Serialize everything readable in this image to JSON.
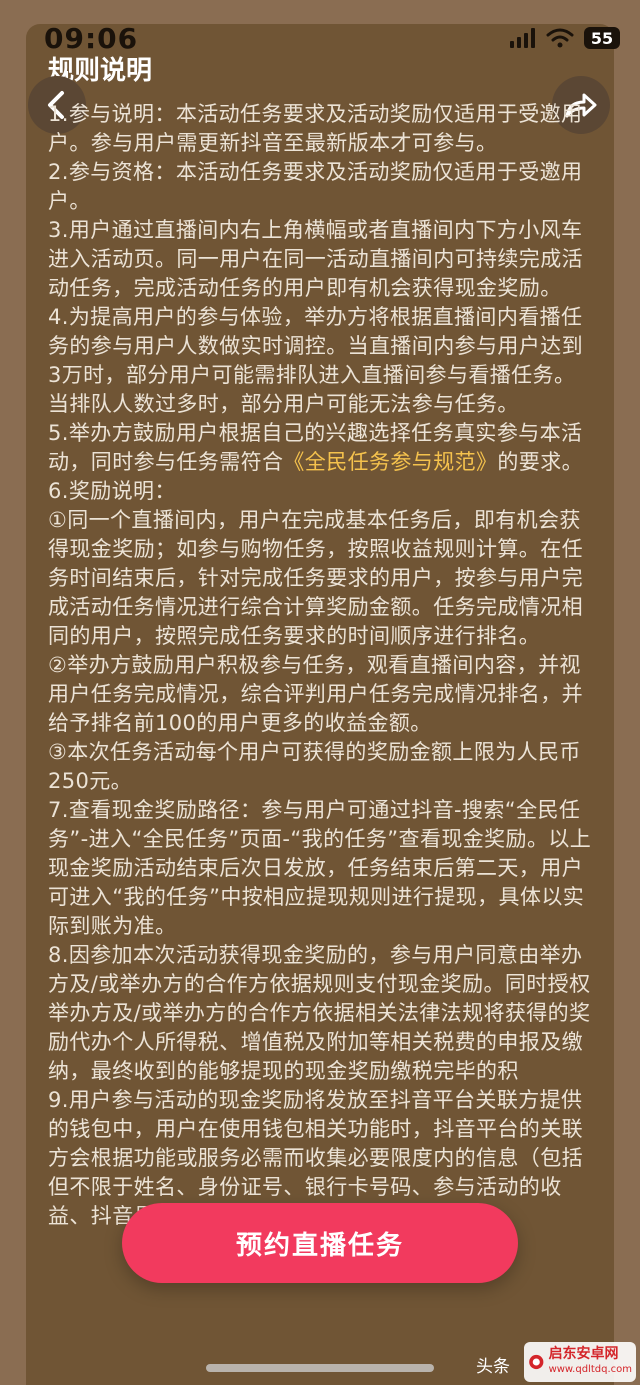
{
  "status_bar": {
    "time": "09:06",
    "battery": "55"
  },
  "header": {
    "title": "规则说明"
  },
  "rules": {
    "p1": "1.参与说明：本活动任务要求及活动奖励仅适用于受邀用户。参与用户需更新抖音至最新版本才可参与。",
    "p2": "2.参与资格：本活动任务要求及活动奖励仅适用于受邀用户。",
    "p3": "3.用户通过直播间内右上角横幅或者直播间内下方小风车进入活动页。同一用户在同一活动直播间内可持续完成活动任务，完成活动任务的用户即有机会获得现金奖励。",
    "p4": "4.为提高用户的参与体验，举办方将根据直播间内看播任务的参与用户人数做实时调控。当直播间内参与用户达到3万时，部分用户可能需排队进入直播间参与看播任务。当排队人数过多时，部分用户可能无法参与任务。",
    "p5_before": "5.举办方鼓励用户根据自己的兴趣选择任务真实参与本活动，同时参与任务需符合",
    "p5_link": "《全民任务参与规范》",
    "p5_after": "的要求。",
    "p6": "6.奖励说明：",
    "p6_1": "①同一个直播间内，用户在完成基本任务后，即有机会获得现金奖励；如参与购物任务，按照收益规则计算。在任务时间结束后，针对完成任务要求的用户，按参与用户完成活动任务情况进行综合计算奖励金额。任务完成情况相同的用户，按照完成任务要求的时间顺序进行排名。",
    "p6_2": "②举办方鼓励用户积极参与任务，观看直播间内容，并视用户任务完成情况，综合评判用户任务完成情况排名，并给予排名前100的用户更多的收益金额。",
    "p6_3": "③本次任务活动每个用户可获得的奖励金额上限为人民币250元。",
    "p7": "7.查看现金奖励路径：参与用户可通过抖音-搜索“全民任务”-进入“全民任务”页面-“我的任务”查看现金奖励。以上现金奖励活动结束后次日发放，任务结束后第二天，用户可进入“我的任务”中按相应提现规则进行提现，具体以实际到账为准。",
    "p8": "8.因参加本次活动获得现金奖励的，参与用户同意由举办方及/或举办方的合作方依据规则支付现金奖励。同时授权举办方及/或举办方的合作方依据相关法律法规将获得的奖励代办个人所得税、增值税及附加等相关税费的申报及缴纳，最终收到的能够提现的现金奖励缴税完毕的积",
    "p9": "9.用户参与活动的现金奖励将发放至抖音平台关联方提供的钱包中，用户在使用钱包相关功能时，抖音平台的关联方会根据功能或服务必需而收集必要限度内的信息（包括但不限于姓名、身份证号、银行卡号码、参与活动的收益、抖音号等）"
  },
  "cta": {
    "label": "预约直播任务"
  },
  "watermark": {
    "source": "头条",
    "site_name": "启东安卓网",
    "site_url": "www.qdltdq.com"
  },
  "colors": {
    "background": "#705535",
    "text": "#ece3d6",
    "link": "#f5c24d",
    "cta": "#f23a5e"
  }
}
